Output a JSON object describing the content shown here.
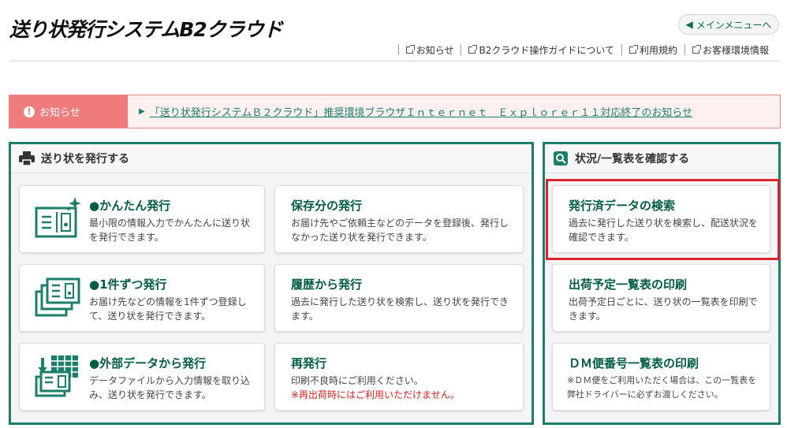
{
  "header": {
    "logo_text": "送り状発行システムB2クラウド",
    "main_menu_label": "メインメニューへ",
    "links": [
      "お知らせ",
      "B2クラウド操作ガイドについて",
      "利用規約",
      "お客様環境情報"
    ]
  },
  "notice": {
    "label": "お知らせ",
    "link_text": "「送り状発行システムＢ２クラウド」推奨環境ブラウザＩｎｔｅｒｎｅｔ　Ｅｘｐｌｏｒｅｒ１１対応終了のお知らせ"
  },
  "issue_panel": {
    "title": "送り状を発行する",
    "cards": [
      {
        "title": "●かんたん発行",
        "desc": "最小限の情報入力でかんたんに送り状を発行できます。"
      },
      {
        "title": "保存分の発行",
        "desc": "お届け先やご依頼主などのデータを登録後、発行しなかった送り状を発行できます。"
      },
      {
        "title": "●1件ずつ発行",
        "desc": "お届け先などの情報を1件ずつ登録して、送り状を発行できます。"
      },
      {
        "title": "履歴から発行",
        "desc": "過去に発行した送り状を検索し、送り状を発行できます。"
      },
      {
        "title": "●外部データから発行",
        "desc": "データファイルから入力情報を取り込み、送り状を発行できます。"
      },
      {
        "title": "再発行",
        "desc": "印刷不良時にご利用ください。",
        "warning": "※再出荷時にはご利用いただけません。"
      }
    ]
  },
  "status_panel": {
    "title": "状況/一覧表を確認する",
    "cards": [
      {
        "title": "発行済データの検索",
        "desc": "過去に発行した送り状を検索し、配送状況を確認できます。"
      },
      {
        "title": "出荷予定一覧表の印刷",
        "desc": "出荷予定日ごとに、送り状の一覧表を印刷できます。"
      },
      {
        "title": "ＤＭ便番号一覧表の印刷",
        "desc": "※ＤＭ便をご利用いただく場合は、この一覧表を弊社ドライバーに必ずお渡しください。"
      }
    ]
  },
  "colors": {
    "accent": "#1b7f6b",
    "title_green": "#005c47",
    "notice_red": "#ef7b7b",
    "highlight": "#d8232a",
    "warning": "#e12020"
  }
}
